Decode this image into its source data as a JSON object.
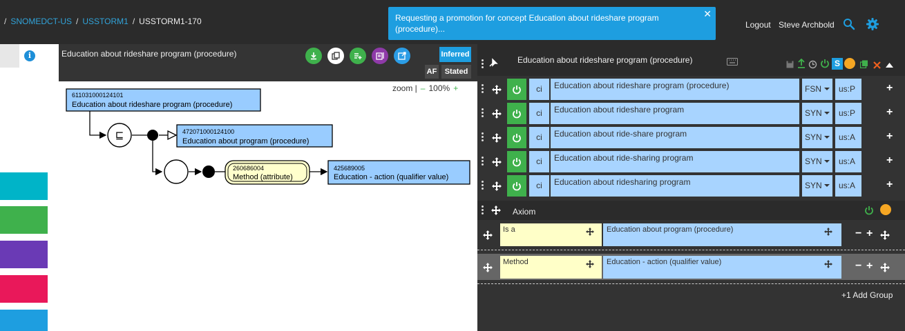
{
  "header": {
    "breadcrumb": [
      "SNOMEDCT-US",
      "USSTORM1",
      "USSTORM1-170"
    ],
    "notification": "Requesting a promotion for concept Education about rideshare program (procedure)...",
    "logout": "Logout",
    "user": "Steve Archbold",
    "icons": [
      "close-icon",
      "search-icon",
      "gear-icon"
    ]
  },
  "sidebar": {
    "swatches": [
      "#00b4c8",
      "#3fb14c",
      "#6a3ab5",
      "#e9185a",
      "#1e9ee0"
    ]
  },
  "diagram_panel": {
    "title": "Education about rideshare program (procedure)",
    "buttons": [
      {
        "name": "download-icon",
        "color": "#3fb14c"
      },
      {
        "name": "copy-icon",
        "color": "#ffffff"
      },
      {
        "name": "add-list-icon",
        "color": "#3fb14c"
      },
      {
        "name": "library-icon",
        "color": "#8e3aa8"
      },
      {
        "name": "open-external-icon",
        "color": "#2b9de6"
      }
    ],
    "view_inferred": "Inferred",
    "view_af": "AF",
    "view_stated": "Stated",
    "zoom_label": "zoom |",
    "zoom_minus": "–",
    "zoom_value": "100%",
    "zoom_plus": "+",
    "nodes": {
      "concept": {
        "id": "611031000124101",
        "label": "Education about rideshare program (procedure)"
      },
      "parent": {
        "id": "472071000124100",
        "label": "Education about program (procedure)"
      },
      "attribute": {
        "id": "260686004",
        "label": "Method (attribute)"
      },
      "value": {
        "id": "425689005",
        "label": "Education - action (qualifier value)"
      }
    },
    "definition_symbol": "⊑"
  },
  "concept_panel": {
    "title": "Education about rideshare program (procedure)",
    "descriptions": [
      {
        "ci": "ci",
        "term": "Education about rideshare program (procedure)",
        "type": "FSN",
        "lang": "us:P"
      },
      {
        "ci": "ci",
        "term": "Education about rideshare program",
        "type": "SYN",
        "lang": "us:P"
      },
      {
        "ci": "ci",
        "term": "Education about ride-share program",
        "type": "SYN",
        "lang": "us:A"
      },
      {
        "ci": "ci",
        "term": "Education about ride-sharing program",
        "type": "SYN",
        "lang": "us:A"
      },
      {
        "ci": "ci",
        "term": "Education about ridesharing program",
        "type": "SYN",
        "lang": "us:A"
      }
    ],
    "axiom_title": "Axiom",
    "relationships": [
      {
        "type": "Is a",
        "target": "Education about program (procedure)"
      },
      {
        "type": "Method",
        "target": "Education - action (qualifier value)"
      }
    ],
    "add_group": "+1 Add Group",
    "toolbar_icons": [
      "save-icon",
      "promote-icon",
      "history-icon",
      "power-icon",
      "s-icon",
      "status-dot-icon",
      "copy-icon",
      "close-icon",
      "collapse-icon"
    ],
    "colors": {
      "accent": "#1e9ee0",
      "green": "#3fb14c",
      "orange": "#f5a623",
      "red": "#e74c3c"
    }
  }
}
